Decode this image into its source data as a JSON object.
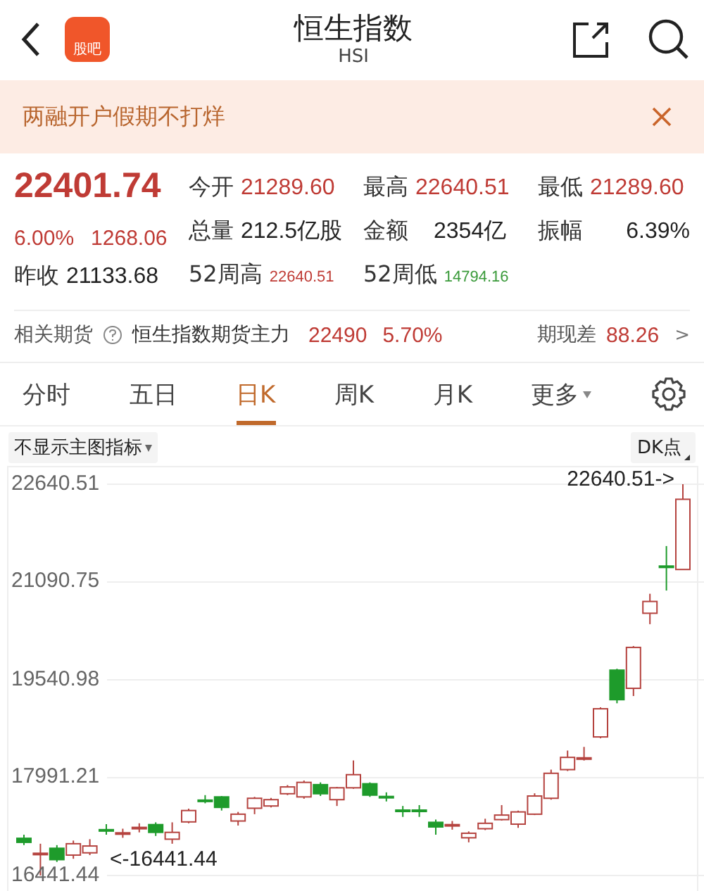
{
  "header": {
    "app_badge": "股吧",
    "title": "恒生指数",
    "subtitle": "HSI"
  },
  "banner": {
    "text": "两融开户假期不打烊"
  },
  "quote": {
    "price": "22401.74",
    "change_pct": "6.00%",
    "change": "1268.06",
    "stats": [
      {
        "label": "今开",
        "value": "21289.60",
        "color": "#bf3b35",
        "kind": "normal"
      },
      {
        "label": "最高",
        "value": "22640.51",
        "color": "#bf3b35",
        "kind": "normal"
      },
      {
        "label": "最低",
        "value": "21289.60",
        "color": "#bf3b35",
        "kind": "normal"
      },
      {
        "label": "总量",
        "value": "212.5亿股",
        "color": "#222222",
        "kind": "normal"
      },
      {
        "label": "金额",
        "value": "2354亿",
        "color": "#222222",
        "kind": "normal"
      },
      {
        "label": "振幅",
        "value": "6.39%",
        "color": "#222222",
        "kind": "normal"
      },
      {
        "label": "昨收",
        "value": "21133.68",
        "color": "#222222",
        "kind": "normal"
      },
      {
        "label": "52周高",
        "value": "22640.51",
        "color": "#bf3b35",
        "kind": "small"
      },
      {
        "label": "52周低",
        "value": "14794.16",
        "color": "#3a9a3a",
        "kind": "small"
      }
    ]
  },
  "futures": {
    "label": "相关期货",
    "name": "恒生指数期货主力",
    "price": "22490",
    "change_pct": "5.70%",
    "basis_label": "期现差",
    "basis": "88.26",
    "arrow": ">"
  },
  "tabs": [
    {
      "label": "分时",
      "selected": false
    },
    {
      "label": "五日",
      "selected": false
    },
    {
      "label": "日K",
      "selected": true
    },
    {
      "label": "周K",
      "selected": false
    },
    {
      "label": "月K",
      "selected": false
    },
    {
      "label": "更多",
      "selected": false
    }
  ],
  "chart_toolbar": {
    "indicator": "不显示主图指标",
    "dk_label": "DK点"
  },
  "chart": {
    "high_marker": "22640.51->",
    "low_marker": "<-16441.44",
    "chart_data": {
      "type": "candlestick",
      "ohlc": [
        [
          17031,
          17089,
          16923,
          16967
        ],
        [
          16779,
          16945,
          16441.44,
          16794
        ],
        [
          16873,
          16923,
          16657,
          16693
        ],
        [
          16765,
          16995,
          16707,
          16945
        ],
        [
          16801,
          17017,
          16765,
          16909
        ],
        [
          17168,
          17255,
          17089,
          17147
        ],
        [
          17096,
          17183,
          17039,
          17118
        ],
        [
          17183,
          17269,
          17125,
          17204
        ],
        [
          17248,
          17284,
          17068,
          17125
        ],
        [
          17017,
          17284,
          16945,
          17125
        ],
        [
          17291,
          17500,
          17269,
          17471
        ],
        [
          17636,
          17715,
          17586,
          17615
        ],
        [
          17687,
          17701,
          17471,
          17521
        ],
        [
          17305,
          17449,
          17233,
          17413
        ],
        [
          17507,
          17687,
          17413,
          17665
        ],
        [
          17543,
          17672,
          17521,
          17643
        ],
        [
          17737,
          17874,
          17715,
          17845
        ],
        [
          17687,
          17946,
          17658,
          17917
        ],
        [
          17881,
          17917,
          17701,
          17737
        ],
        [
          17643,
          17845,
          17543,
          17831
        ],
        [
          17831,
          18263,
          17816,
          18039
        ],
        [
          17895,
          17917,
          17687,
          17715
        ],
        [
          17694,
          17759,
          17615,
          17672
        ],
        [
          17478,
          17543,
          17370,
          17457
        ],
        [
          17478,
          17557,
          17370,
          17457
        ],
        [
          17284,
          17327,
          17089,
          17211
        ],
        [
          17226,
          17305,
          17168,
          17248
        ],
        [
          17039,
          17140,
          16967,
          17111
        ],
        [
          17183,
          17341,
          17161,
          17269
        ],
        [
          17327,
          17557,
          17312,
          17399
        ],
        [
          17255,
          17471,
          17197,
          17449
        ],
        [
          17413,
          17744,
          17399,
          17701
        ],
        [
          17665,
          18119,
          17643,
          18061
        ],
        [
          18119,
          18421,
          18097,
          18313
        ],
        [
          18284,
          18479,
          18263,
          18306
        ],
        [
          18637,
          19105,
          18615,
          19083
        ],
        [
          19695,
          19717,
          19170,
          19227
        ],
        [
          19407,
          20077,
          19285,
          20055
        ],
        [
          20596,
          20905,
          20423,
          20783
        ],
        [
          21344,
          21661,
          20956,
          21323
        ],
        [
          21289.6,
          22640.51,
          21289.6,
          22401.74
        ]
      ],
      "ylim": [
        16441.44,
        22640.51
      ],
      "grid": true,
      "yticks": [
        {
          "value": 22640.51,
          "label": "22640.51"
        },
        {
          "value": 21090.75,
          "label": "21090.75"
        },
        {
          "value": 19540.98,
          "label": "19540.98"
        },
        {
          "value": 17991.21,
          "label": "17991.21"
        },
        {
          "value": 16441.44,
          "label": "16441.44"
        }
      ]
    }
  }
}
